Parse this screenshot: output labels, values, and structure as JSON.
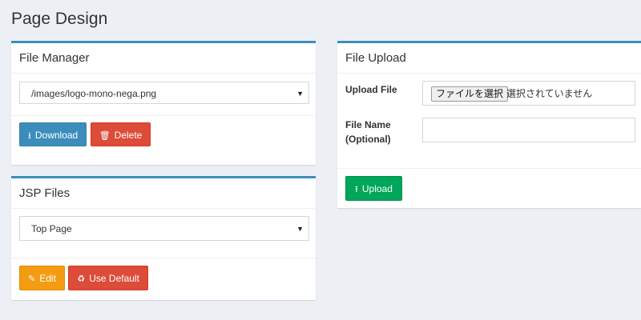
{
  "page": {
    "title": "Page Design"
  },
  "file_manager": {
    "title": "File Manager",
    "selected_file": "/images/logo-mono-nega.png",
    "download_label": "Download",
    "delete_label": "Delete"
  },
  "jsp_files": {
    "title": "JSP Files",
    "selected_page": "Top Page",
    "edit_label": "Edit",
    "use_default_label": "Use Default"
  },
  "file_upload": {
    "title": "File Upload",
    "upload_file_label": "Upload File",
    "choose_file_button": "ファイルを選択",
    "no_file_selected": "選択されていません",
    "file_name_label_line1": "File Name",
    "file_name_label_line2": "(Optional)",
    "file_name_value": "",
    "upload_label": "Upload"
  },
  "icons": {
    "download": "download-icon",
    "delete": "trash-icon",
    "edit": "pencil-icon",
    "use_default": "recycle-icon",
    "upload": "upload-icon",
    "dropdown": "caret-down-icon"
  },
  "colors": {
    "background": "#ecf0f5",
    "panel_border": "#3c8dbc",
    "primary": "#3c8dbc",
    "danger": "#dd4b39",
    "warning": "#f39c12",
    "success": "#00a65a"
  }
}
